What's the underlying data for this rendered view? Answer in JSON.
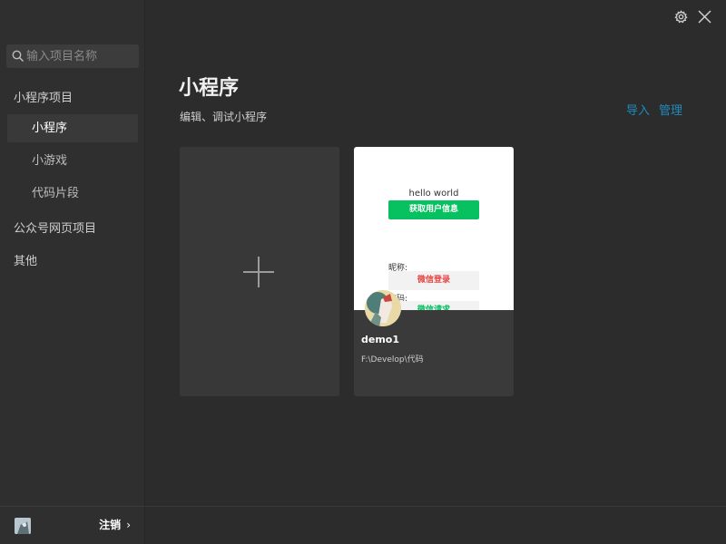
{
  "sidebar": {
    "search_placeholder": "输入项目名称",
    "groups": [
      {
        "label": "小程序项目"
      },
      {
        "label": "公众号网页项目"
      },
      {
        "label": "其他"
      }
    ],
    "items": [
      {
        "label": "小程序",
        "active": true
      },
      {
        "label": "小游戏",
        "active": false
      },
      {
        "label": "代码片段",
        "active": false
      }
    ],
    "footer": {
      "logout_label": "注销",
      "chevron": "›"
    }
  },
  "topbar": {
    "icons": [
      "gear-icon",
      "close-icon"
    ]
  },
  "main": {
    "title": "小程序",
    "subtitle": "编辑、调试小程序",
    "links": {
      "import": "导入",
      "manage": "管理"
    }
  },
  "projects": [
    {
      "name": "demo1",
      "path": "F:\\Develop\\代码",
      "preview": {
        "hello": "hello world",
        "get_user_info": "获取用户信息",
        "nickname_label": "昵称:",
        "wechat_login": "微信登录",
        "code_label": "权码:",
        "partial_button": "微信请求"
      }
    }
  ],
  "colors": {
    "accent_link": "#1f8bbf",
    "wechat_green": "#07c160",
    "login_red": "#e64340",
    "background": "#2c2c2c",
    "sidebar": "#2f2f2f"
  }
}
